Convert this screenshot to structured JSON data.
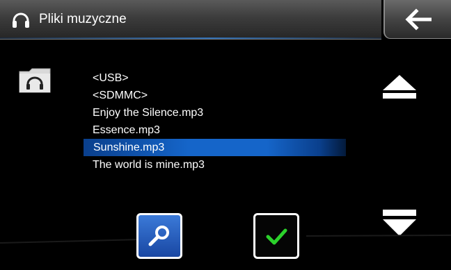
{
  "header": {
    "title": "Pliki muzyczne",
    "title_icon": "headphones-icon",
    "back_icon": "arrow-left-icon"
  },
  "file_list": {
    "items": [
      {
        "label": "<USB>",
        "selected": false
      },
      {
        "label": "<SDMMC>",
        "selected": false
      },
      {
        "label": "Enjoy the Silence.mp3",
        "selected": false
      },
      {
        "label": "Essence.mp3",
        "selected": false
      },
      {
        "label": "Sunshine.mp3",
        "selected": true
      },
      {
        "label": "The world is mine.mp3",
        "selected": false
      }
    ]
  },
  "controls": {
    "folder_icon": "folder-headphones-icon",
    "scroll_up_icon": "eject-up-icon",
    "scroll_down_icon": "eject-down-icon",
    "search_icon": "search-icon",
    "confirm_icon": "checkmark-icon"
  },
  "colors": {
    "selection": "#1565c9",
    "accent_line": "#2f6fb5",
    "confirm_check": "#2bd12b",
    "search_bg": "#2a63c4"
  }
}
